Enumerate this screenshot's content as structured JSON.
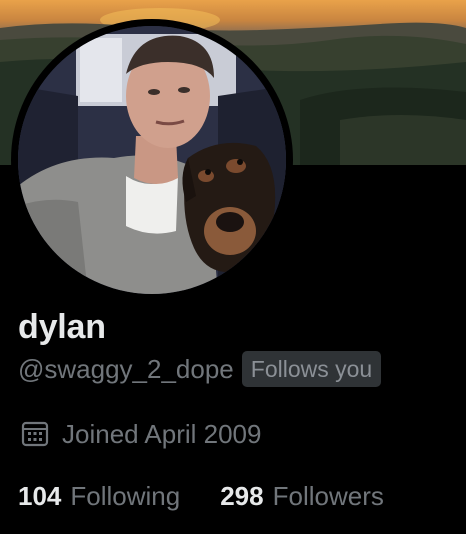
{
  "profile": {
    "display_name": "dylan",
    "handle": "@swaggy_2_dope",
    "follows_you_badge": "Follows you",
    "joined": "Joined April 2009",
    "joined_icon": "calendar-icon"
  },
  "stats": {
    "following_count": "104",
    "following_label": "Following",
    "followers_count": "298",
    "followers_label": "Followers"
  },
  "colors": {
    "background": "#000000",
    "primary_text": "#e7e9ea",
    "secondary_text": "#71767b",
    "badge_background": "#2f3336"
  }
}
